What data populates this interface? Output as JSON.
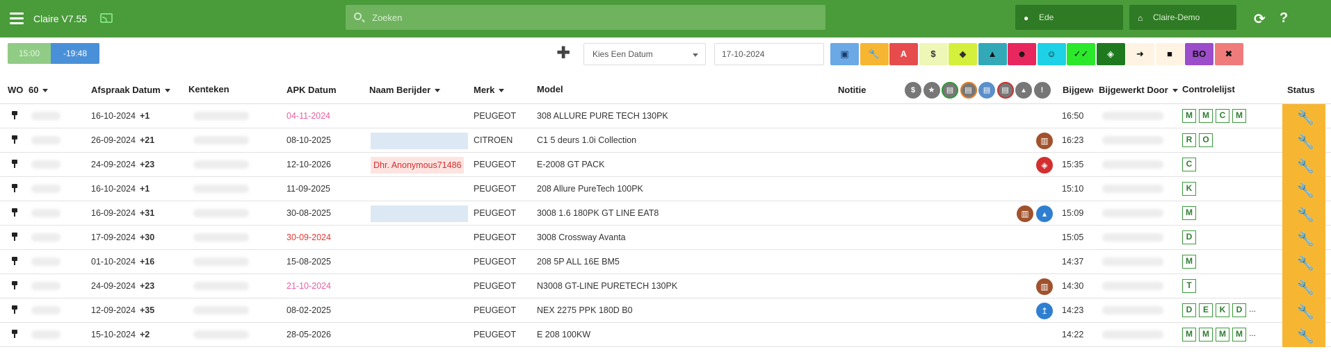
{
  "header": {
    "app_title": "Claire V7.55",
    "search_placeholder": "Zoeken",
    "location": "Ede",
    "company": "Claire-Demo"
  },
  "toolbar": {
    "time_1": "15:00",
    "time_2": "-19:48",
    "date_select": "Kies Een Datum",
    "date_value": "17-10-2024",
    "filter_buttons": [
      {
        "icon": "calendar-icon",
        "label": "▣",
        "bg": "#6aa8e6",
        "fg": "#1a3e6b"
      },
      {
        "icon": "wrench-icon",
        "label": "🔧",
        "bg": "#f7b632",
        "fg": "#111"
      },
      {
        "icon": "text-a-icon",
        "label": "A",
        "bg": "#e74c4c",
        "fg": "#fff"
      },
      {
        "icon": "dollar-icon",
        "label": "$",
        "bg": "#eef7b5",
        "fg": "#333"
      },
      {
        "icon": "tag-icon",
        "label": "◆",
        "bg": "#d4f03c",
        "fg": "#333"
      },
      {
        "icon": "warning-icon",
        "label": "▲",
        "bg": "#33a9b8",
        "fg": "#111"
      },
      {
        "icon": "user-edit-icon",
        "label": "☻",
        "bg": "#e8275e",
        "fg": "#111"
      },
      {
        "icon": "smile-icon",
        "label": "☺",
        "bg": "#1ed1e6",
        "fg": "#111"
      },
      {
        "icon": "double-check-icon",
        "label": "✓✓",
        "bg": "#2be82b",
        "fg": "#111"
      },
      {
        "icon": "shield-check-icon",
        "label": "◈",
        "bg": "#1f7a1f",
        "fg": "#fff"
      },
      {
        "icon": "exit-icon",
        "label": "➜",
        "bg": "#fff3e3",
        "fg": "#111"
      },
      {
        "icon": "car-icon",
        "label": "■",
        "bg": "#fff3e3",
        "fg": "#111"
      },
      {
        "icon": "bo-icon",
        "label": "BO",
        "bg": "#9b4dca",
        "fg": "#111"
      },
      {
        "icon": "close-circle-icon",
        "label": "✖",
        "bg": "#f07b7b",
        "fg": "#111"
      }
    ]
  },
  "table": {
    "headers": {
      "wo": "WO",
      "count": "60",
      "afspraak": "Afspraak Datum",
      "kenteken": "Kenteken",
      "apk": "APK Datum",
      "berijder": "Naam Berijder",
      "merk": "Merk",
      "model": "Model",
      "notitie": "Notitie",
      "bijgewerkt": "Bijgewe",
      "bijgewerkt_door": "Bijgewerkt Door",
      "controlelijst": "Controlelijst",
      "status": "Status"
    },
    "filter_icons": [
      {
        "name": "dollar-filter-icon",
        "glyph": "$",
        "bg": "#777",
        "ring": ""
      },
      {
        "name": "star-filter-icon",
        "glyph": "★",
        "bg": "#777",
        "ring": ""
      },
      {
        "name": "cart-green-filter-icon",
        "glyph": "▤",
        "bg": "#777",
        "ring": "#2e9b3a"
      },
      {
        "name": "cart-orange-filter-icon",
        "glyph": "▤",
        "bg": "#777",
        "ring": "#e67e22"
      },
      {
        "name": "cart-blue-filter-icon",
        "glyph": "▤",
        "bg": "#5b8fc9",
        "ring": ""
      },
      {
        "name": "cart-red-filter-icon",
        "glyph": "▤",
        "bg": "#777",
        "ring": "#d32f2f"
      },
      {
        "name": "pin-filter-icon",
        "glyph": "▴",
        "bg": "#777",
        "ring": ""
      },
      {
        "name": "warning-filter-icon",
        "glyph": "!",
        "bg": "#777",
        "ring": ""
      }
    ],
    "rows": [
      {
        "afspraak": "16-10-2024",
        "diff": "+1",
        "apk": "04-11-2024",
        "apk_color": "#e860a0",
        "driver": "",
        "driver_type": "none",
        "merk": "PEUGEOT",
        "model": "308 ALLURE PURE TECH 130PK",
        "icons": [],
        "time": "16:50",
        "checklist": [
          "M",
          "M",
          "C",
          "M"
        ],
        "more": ""
      },
      {
        "afspraak": "26-09-2024",
        "diff": "+21",
        "apk": "08-10-2025",
        "apk_color": "#333",
        "driver": "",
        "driver_type": "box",
        "merk": "CITROEN",
        "model": "C1 5 deurs 1.0i Collection",
        "icons": [
          {
            "name": "coffee-icon",
            "bg": "#a0522d",
            "glyph": "▥"
          }
        ],
        "time": "16:23",
        "checklist": [
          "R",
          "O"
        ],
        "more": ""
      },
      {
        "afspraak": "24-09-2024",
        "diff": "+23",
        "apk": "12-10-2026",
        "apk_color": "#333",
        "driver": "Dhr. Anonymous71486",
        "driver_type": "tag",
        "merk": "PEUGEOT",
        "model": "E-2008 GT PACK",
        "icons": [
          {
            "name": "shield-icon",
            "bg": "#d32f2f",
            "glyph": "◈"
          }
        ],
        "time": "15:35",
        "checklist": [
          "C"
        ],
        "more": ""
      },
      {
        "afspraak": "16-10-2024",
        "diff": "+1",
        "apk": "11-09-2025",
        "apk_color": "#333",
        "driver": "",
        "driver_type": "none",
        "merk": "PEUGEOT",
        "model": "208 Allure PureTech 100PK",
        "icons": [],
        "time": "15:10",
        "checklist": [
          "K"
        ],
        "more": ""
      },
      {
        "afspraak": "16-09-2024",
        "diff": "+31",
        "apk": "30-08-2025",
        "apk_color": "#333",
        "driver": "",
        "driver_type": "box",
        "merk": "PEUGEOT",
        "model": "3008 1.6 180PK GT LINE EAT8",
        "icons": [
          {
            "name": "coffee-icon",
            "bg": "#a0522d",
            "glyph": "▥"
          },
          {
            "name": "pin-icon",
            "bg": "#2f7fd0",
            "glyph": "▴"
          }
        ],
        "time": "15:09",
        "checklist": [
          "M"
        ],
        "more": ""
      },
      {
        "afspraak": "17-09-2024",
        "diff": "+30",
        "apk": "30-09-2024",
        "apk_color": "#e53935",
        "driver": "",
        "driver_type": "none",
        "merk": "PEUGEOT",
        "model": "3008 Crossway Avanta",
        "icons": [],
        "time": "15:05",
        "checklist": [
          "D"
        ],
        "more": ""
      },
      {
        "afspraak": "01-10-2024",
        "diff": "+16",
        "apk": "15-08-2025",
        "apk_color": "#333",
        "driver": "",
        "driver_type": "none",
        "merk": "PEUGEOT",
        "model": "208 5P ALL 16E BM5",
        "icons": [],
        "time": "14:37",
        "checklist": [
          "M"
        ],
        "more": ""
      },
      {
        "afspraak": "24-09-2024",
        "diff": "+23",
        "apk": "21-10-2024",
        "apk_color": "#e860a0",
        "driver": "",
        "driver_type": "none",
        "merk": "PEUGEOT",
        "model": "N3008 GT-LINE PURETECH 130PK",
        "icons": [
          {
            "name": "coffee-icon",
            "bg": "#a0522d",
            "glyph": "▥"
          }
        ],
        "time": "14:30",
        "checklist": [
          "T"
        ],
        "more": ""
      },
      {
        "afspraak": "12-09-2024",
        "diff": "+35",
        "apk": "08-02-2025",
        "apk_color": "#333",
        "driver": "",
        "driver_type": "none",
        "merk": "PEUGEOT",
        "model": "NEX 2275 PPK 180D B0",
        "icons": [
          {
            "name": "upload-icon",
            "bg": "#2f7fd0",
            "glyph": "↥"
          }
        ],
        "time": "14:23",
        "checklist": [
          "D",
          "E",
          "K",
          "D"
        ],
        "more": "..."
      },
      {
        "afspraak": "15-10-2024",
        "diff": "+2",
        "apk": "28-05-2026",
        "apk_color": "#333",
        "driver": "",
        "driver_type": "none",
        "merk": "PEUGEOT",
        "model": "E 208 100KW",
        "icons": [],
        "time": "14:22",
        "checklist": [
          "M",
          "M",
          "M",
          "M"
        ],
        "more": "..."
      }
    ]
  },
  "colors": {
    "header_green": "#4a9b3a",
    "status_orange": "#f7b632",
    "checklist_green": "#2e7d32"
  }
}
